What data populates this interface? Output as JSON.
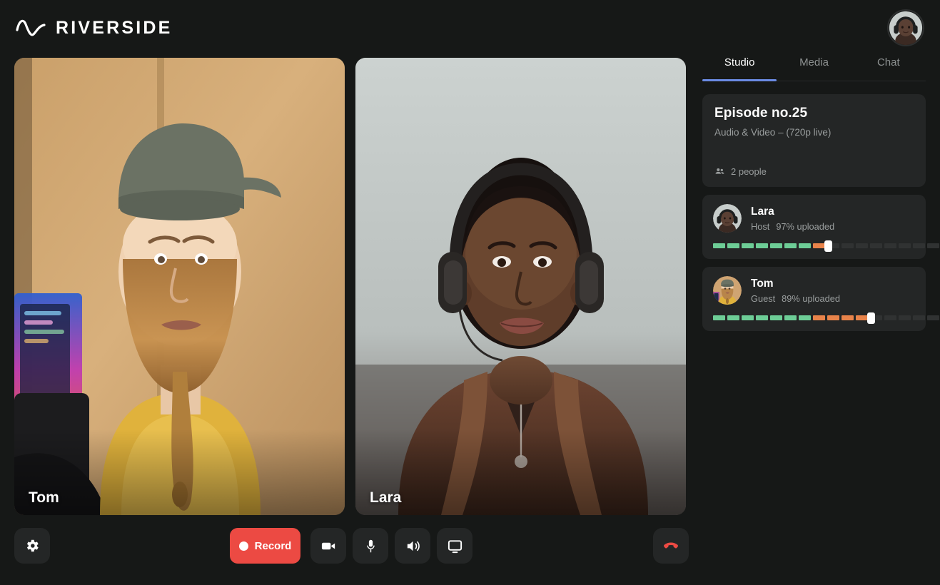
{
  "header": {
    "brand": "RIVERSIDE",
    "logo_icon": "waveform-icon",
    "avatar_name": "Lara"
  },
  "stage": {
    "tiles": [
      {
        "name": "Tom",
        "scene": "tom"
      },
      {
        "name": "Lara",
        "scene": "lara"
      }
    ]
  },
  "toolbar": {
    "settings": {
      "label": "Settings",
      "icon": "gear-icon"
    },
    "record": {
      "label": "Record",
      "icon": "record-dot-icon",
      "color": "#ec4a43"
    },
    "camera": {
      "label": "Camera",
      "icon": "video-camera-icon"
    },
    "mic": {
      "label": "Microphone",
      "icon": "microphone-icon"
    },
    "speaker": {
      "label": "Speaker",
      "icon": "speaker-icon"
    },
    "screen": {
      "label": "Share screen",
      "icon": "monitor-icon"
    },
    "hangup": {
      "label": "Leave studio",
      "icon": "phone-hangup-icon",
      "color": "#ec4a43"
    }
  },
  "panel": {
    "tabs": [
      {
        "label": "Studio",
        "active": true
      },
      {
        "label": "Media",
        "active": false
      },
      {
        "label": "Chat",
        "active": false
      }
    ],
    "accent": "#6b8be4",
    "episode": {
      "title": "Episode no.25",
      "subtitle": "Audio & Video – (720p live)",
      "people_icon": "people-icon",
      "people_count": "2 people"
    },
    "participants": [
      {
        "name": "Lara",
        "role": "Host",
        "upload": "97% uploaded",
        "avatar": "lara",
        "meter": {
          "green": 7,
          "orange": 1,
          "off": 8,
          "thumb_index": 8
        }
      },
      {
        "name": "Tom",
        "role": "Guest",
        "upload": "89% uploaded",
        "avatar": "tom",
        "meter": {
          "green": 7,
          "orange": 4,
          "off": 5,
          "thumb_index": 11
        }
      }
    ]
  }
}
